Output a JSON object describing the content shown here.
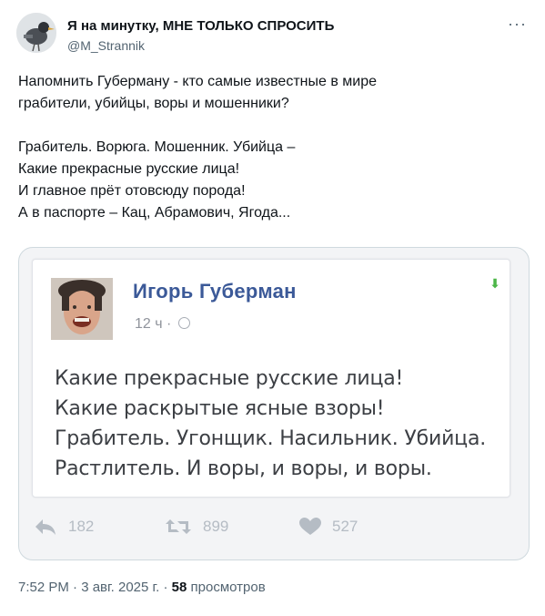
{
  "header": {
    "display_name": "Я на минутку, МНЕ ТОЛЬКО СПРОСИТЬ",
    "handle": "@M_Strannik",
    "more_label": "···"
  },
  "tweet": {
    "lines_1": [
      "Напомнить Губерману - кто самые известные в мире",
      "грабители, убийцы, воры и мошенники?"
    ],
    "lines_2": [
      "Грабитель. Ворюга. Мошенник. Убийца –",
      "Какие прекрасные русские лица!",
      "И главное прёт отовсюду порода!",
      "А в паспорте – Кац, Абрамович, Ягода..."
    ]
  },
  "embedded_post": {
    "author": "Игорь Губерман",
    "time": "12 ч ·",
    "lines": [
      "Какие прекрасные русские лица!",
      "Какие раскрытые ясные взоры!",
      "Грабитель. Угонщик. Насильник. Убийца.",
      "Растлитель. И воры, и воры, и воры."
    ],
    "stats": {
      "replies": "182",
      "retweets": "899",
      "likes": "527"
    }
  },
  "footer": {
    "datetime": "7:52 PM · 3 авг. 2025 г. · ",
    "views_count": "58",
    "views_label": " просмотров"
  },
  "colors": {
    "fb_author": "#3b5998",
    "stat_gray": "#b5bcc4",
    "border": "#cfd9de"
  }
}
